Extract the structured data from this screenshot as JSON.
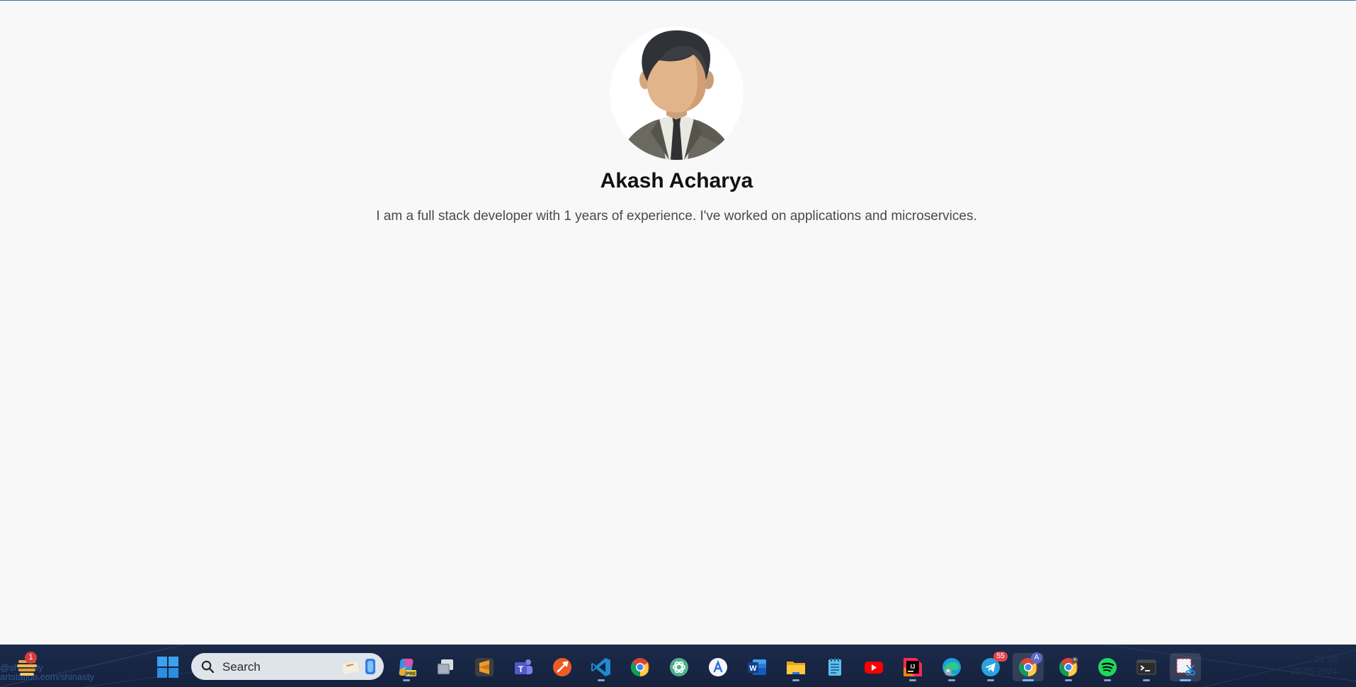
{
  "profile": {
    "name": "Akash Acharya",
    "bio": "I am a full stack developer with 1 years of experience. I've worked on applications and microservices."
  },
  "taskbar": {
    "watermark": [
      "@shinasty",
      "artstation.com/shinasty"
    ],
    "widgets_badge": "1",
    "search_placeholder": "Search",
    "apps": [
      {
        "name": "copilot-icon"
      },
      {
        "name": "task-view-icon"
      },
      {
        "name": "sublime-text-icon"
      },
      {
        "name": "teams-icon"
      },
      {
        "name": "postman-icon"
      },
      {
        "name": "vscode-icon"
      },
      {
        "name": "chrome-icon"
      },
      {
        "name": "chatgpt-icon"
      },
      {
        "name": "app-store-icon"
      },
      {
        "name": "word-icon"
      },
      {
        "name": "file-explorer-icon"
      },
      {
        "name": "notepad-icon"
      },
      {
        "name": "youtube-icon"
      },
      {
        "name": "intellij-icon"
      },
      {
        "name": "edge-icon"
      },
      {
        "name": "telegram-icon",
        "badge": "55"
      },
      {
        "name": "chrome-profile-a-icon",
        "badge": "A"
      },
      {
        "name": "chrome-profile-2-icon"
      },
      {
        "name": "spotify-icon"
      },
      {
        "name": "terminal-icon"
      },
      {
        "name": "snipping-tool-icon"
      }
    ],
    "clock": {
      "time": "21:36",
      "date": "25-05-2024"
    }
  },
  "colors": {
    "page_background": "#f8f8f8",
    "taskbar_background": "#1b2a4a",
    "accent": "#3d6fae"
  }
}
